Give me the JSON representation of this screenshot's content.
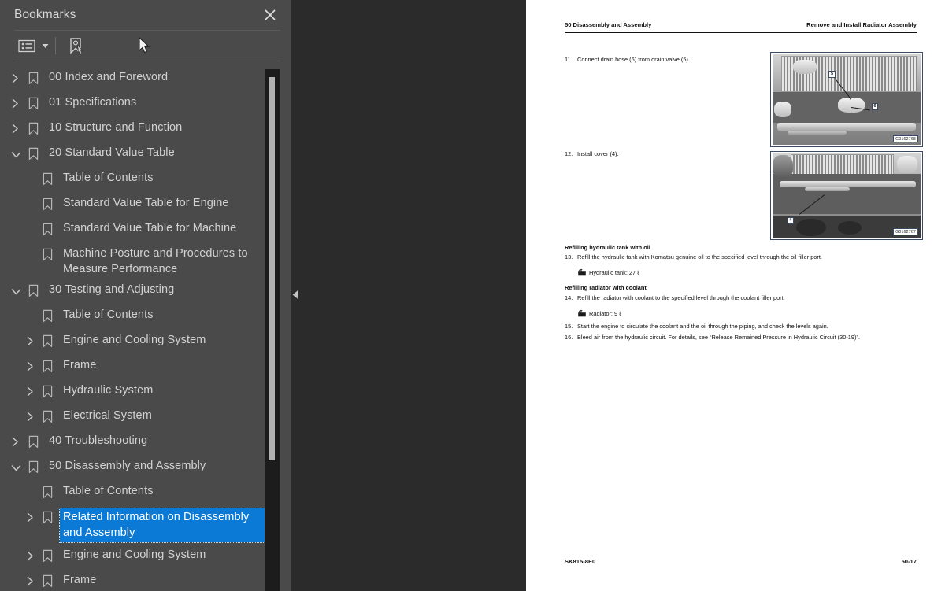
{
  "panel": {
    "title": "Bookmarks",
    "close_icon": "close-icon",
    "toolbar": {
      "list_options_icon": "list-options-icon",
      "dropdown_caret_icon": "chevron-down-icon",
      "add_bookmark_icon": "bookmark-pointer-icon"
    },
    "collapse_handle_icon": "collapse-left-triangle-icon",
    "selection_color": "#0a7ad6",
    "background_color": "#4a4a4a",
    "text_color": "#d2d2d2"
  },
  "bookmarks": [
    {
      "label": "00 Index and Foreword",
      "level": 1,
      "state": "collapsed",
      "selected": false
    },
    {
      "label": "01 Specifications",
      "level": 1,
      "state": "collapsed",
      "selected": false
    },
    {
      "label": "10 Structure and Function",
      "level": 1,
      "state": "collapsed",
      "selected": false
    },
    {
      "label": "20 Standard Value Table",
      "level": 1,
      "state": "expanded",
      "selected": false
    },
    {
      "label": "Table of Contents",
      "level": 2,
      "state": "leaf",
      "selected": false
    },
    {
      "label": "Standard Value Table for Engine",
      "level": 2,
      "state": "leaf",
      "selected": false
    },
    {
      "label": "Standard Value Table for Machine",
      "level": 2,
      "state": "leaf",
      "selected": false
    },
    {
      "label": "Machine Posture and Procedures to Measure Performance",
      "level": 2,
      "state": "leaf",
      "selected": false
    },
    {
      "label": "30 Testing and Adjusting",
      "level": 1,
      "state": "expanded",
      "selected": false
    },
    {
      "label": "Table of Contents",
      "level": 2,
      "state": "leaf",
      "selected": false
    },
    {
      "label": "Engine and Cooling System",
      "level": 2,
      "state": "collapsed",
      "selected": false
    },
    {
      "label": "Frame",
      "level": 2,
      "state": "collapsed",
      "selected": false
    },
    {
      "label": "Hydraulic System",
      "level": 2,
      "state": "collapsed",
      "selected": false
    },
    {
      "label": "Electrical System",
      "level": 2,
      "state": "collapsed",
      "selected": false
    },
    {
      "label": "40 Troubleshooting",
      "level": 1,
      "state": "collapsed",
      "selected": false
    },
    {
      "label": "50 Disassembly and Assembly",
      "level": 1,
      "state": "expanded",
      "selected": false
    },
    {
      "label": "Table of Contents",
      "level": 2,
      "state": "leaf",
      "selected": false
    },
    {
      "label": "Related Information on Disassembly and Assembly",
      "level": 2,
      "state": "collapsed",
      "selected": true
    },
    {
      "label": "Engine and Cooling System",
      "level": 2,
      "state": "collapsed",
      "selected": false
    },
    {
      "label": "Frame",
      "level": 2,
      "state": "collapsed",
      "selected": false
    }
  ],
  "document": {
    "header_left": "50 Disassembly and Assembly",
    "header_right": "Remove and Install Radiator Assembly",
    "footer_left": "SK815-8E0",
    "footer_right": "50-17",
    "steps": [
      {
        "num": "11.",
        "text": "Connect drain hose (6) from drain valve (5)."
      },
      {
        "num": "12.",
        "text": "Install cover (4)."
      },
      {
        "num": "13.",
        "text": "Refill the hydraulic tank with Komatsu genuine oil to the specified level through the oil filler port."
      },
      {
        "num": "14.",
        "text": "Refill the radiator with coolant to the specified level through the coolant filler port."
      },
      {
        "num": "15.",
        "text": "Start the engine to circulate the coolant and the oil through the piping, and check the levels again."
      },
      {
        "num": "16.",
        "text": "Bleed air from the hydraulic circuit. For details, see “Release Remained Pressure in Hydraulic Circuit (30-19)”."
      }
    ],
    "section_heading_1": "Refilling hydraulic tank with oil",
    "section_heading_2": "Refilling radiator with coolant",
    "spec_1": "Hydraulic tank: 27 ℓ",
    "spec_2": "Radiator: 9 ℓ",
    "spec_icon": "fill-level-icon",
    "figures": [
      {
        "id": "G0162768",
        "callouts": [
          "5",
          "6"
        ]
      },
      {
        "id": "G0162767",
        "callouts": [
          "4"
        ]
      }
    ]
  }
}
